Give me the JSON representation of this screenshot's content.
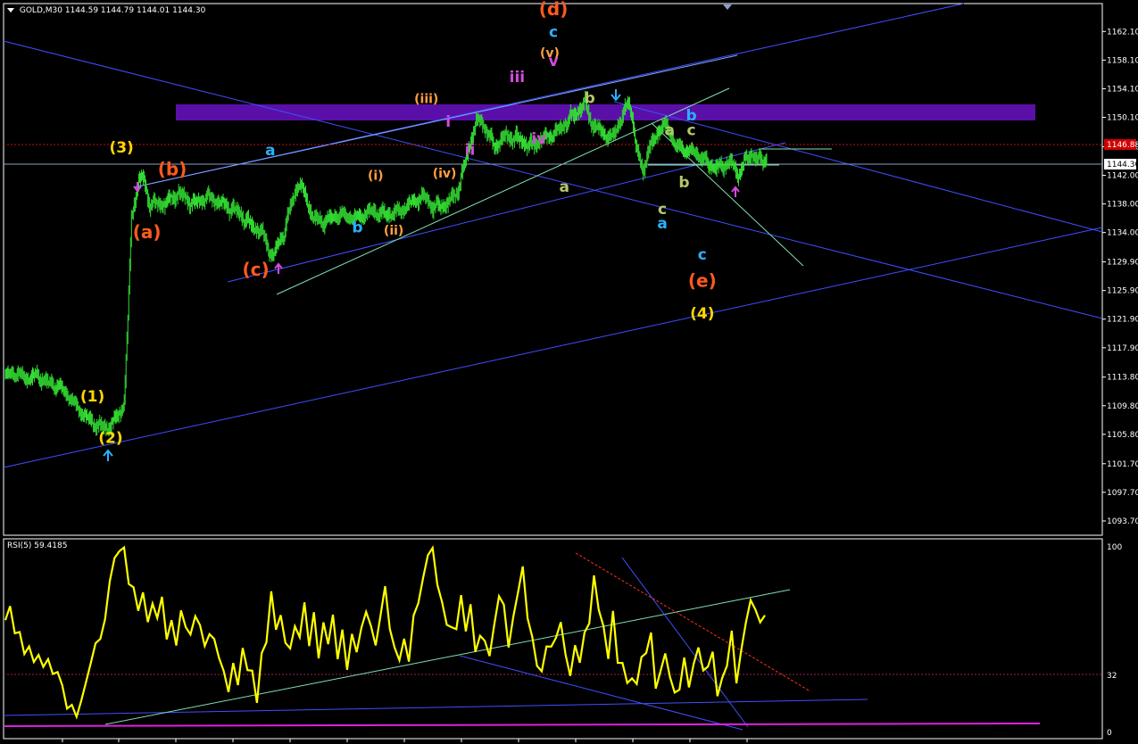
{
  "header": {
    "symbol": "GOLD,M30",
    "ohlc": "1144.59 1144.79 1144.01 1144.30"
  },
  "rsi_header": {
    "label": "RSI(5) 59.4185"
  },
  "colors": {
    "background": "#000000",
    "candle": "#33dd33",
    "rsi_line": "#ffff00",
    "grid_text": "#ffffff",
    "channel": "#3f4fff",
    "zone": "#5a10a8",
    "orange": "#ff5a1f",
    "yellow": "#ffd700",
    "cyan": "#2ab0ff",
    "olive": "#b5c76a",
    "magenta": "#d54be0",
    "amber": "#ffa040",
    "current_price_bg": "#ffffff",
    "high_price_bg": "#d00000"
  },
  "chart_data": [
    {
      "type": "candlestick",
      "title": "GOLD,M30",
      "ylim": [
        1091.7,
        1166.0
      ],
      "y_ticks": [
        "1162.10",
        "1158.10",
        "1154.10",
        "1150.10",
        "1146.00",
        "1142.00",
        "1138.00",
        "1134.00",
        "1129.90",
        "1125.90",
        "1121.90",
        "1117.90",
        "1113.80",
        "1109.80",
        "1105.80",
        "1101.70",
        "1097.70",
        "1093.70"
      ],
      "current_price": "1144.30",
      "high_price": "1146.88",
      "close_path": [
        [
          0,
          1114
        ],
        [
          3,
          1114.4
        ],
        [
          6,
          1113.6
        ],
        [
          9,
          1114
        ],
        [
          12,
          1113
        ],
        [
          15,
          1112.5
        ],
        [
          18,
          1111
        ],
        [
          20,
          1109.5
        ],
        [
          22,
          1108.5
        ],
        [
          24,
          1107.5
        ],
        [
          26,
          1107
        ],
        [
          28,
          1106.6
        ],
        [
          30,
          1107.5
        ],
        [
          32,
          1109
        ],
        [
          33,
          1110.5
        ],
        [
          34,
          1122
        ],
        [
          35,
          1136
        ],
        [
          36,
          1139
        ],
        [
          37,
          1141
        ],
        [
          38,
          1142
        ],
        [
          39,
          1140
        ],
        [
          40,
          1138
        ],
        [
          44,
          1138
        ],
        [
          48,
          1139.5
        ],
        [
          52,
          1138
        ],
        [
          56,
          1139
        ],
        [
          60,
          1138
        ],
        [
          64,
          1137
        ],
        [
          68,
          1135
        ],
        [
          71,
          1134
        ],
        [
          73,
          1131.5
        ],
        [
          74,
          1130.5
        ],
        [
          75,
          1132
        ],
        [
          77,
          1134
        ],
        [
          79,
          1138
        ],
        [
          81,
          1141
        ],
        [
          83,
          1139
        ],
        [
          85,
          1136
        ],
        [
          88,
          1135.5
        ],
        [
          92,
          1136.5
        ],
        [
          97,
          1136
        ],
        [
          101,
          1137
        ],
        [
          105,
          1136.5
        ],
        [
          109,
          1137
        ],
        [
          113,
          1138.5
        ],
        [
          116,
          1139
        ],
        [
          118,
          1137.5
        ],
        [
          122,
          1138
        ],
        [
          125,
          1140
        ],
        [
          127,
          1144
        ],
        [
          129,
          1148
        ],
        [
          131,
          1150
        ],
        [
          133,
          1148
        ],
        [
          135,
          1146
        ],
        [
          138,
          1147.5
        ],
        [
          142,
          1147
        ],
        [
          145,
          1146
        ],
        [
          148,
          1147
        ],
        [
          152,
          1148
        ],
        [
          155,
          1149.5
        ],
        [
          158,
          1151
        ],
        [
          160,
          1152
        ],
        [
          162,
          1149
        ],
        [
          165,
          1148
        ],
        [
          167,
          1147
        ],
        [
          169,
          1149
        ],
        [
          171,
          1151
        ],
        [
          172,
          1152.5
        ],
        [
          173,
          1150
        ],
        [
          174,
          1146
        ],
        [
          175,
          1144
        ],
        [
          176,
          1142.5
        ],
        [
          177,
          1145
        ],
        [
          179,
          1147
        ],
        [
          181,
          1149
        ],
        [
          183,
          1148.5
        ],
        [
          185,
          1146
        ],
        [
          188,
          1145.5
        ],
        [
          191,
          1145
        ],
        [
          194,
          1143.5
        ],
        [
          197,
          1143
        ],
        [
          200,
          1144
        ],
        [
          202,
          1142
        ],
        [
          204,
          1144
        ],
        [
          206,
          1145
        ],
        [
          208,
          1144
        ],
        [
          210,
          1144.3
        ]
      ],
      "price_channel_zone": [
        1150.2,
        1152.3
      ]
    },
    {
      "type": "line",
      "title": "RSI(5) 59.4185",
      "ylim": [
        0,
        100
      ],
      "y_ticks": [
        "100",
        "32",
        "0"
      ],
      "series": [
        {
          "name": "RSI(5)",
          "values": [
            60,
            68,
            52,
            55,
            40,
            48,
            35,
            44,
            32,
            42,
            28,
            35,
            22,
            15,
            12,
            10,
            15,
            28,
            36,
            48,
            50,
            60,
            82,
            92,
            99,
            97,
            82,
            75,
            68,
            72,
            62,
            66,
            64,
            70,
            52,
            58,
            48,
            64,
            57,
            52,
            62,
            58,
            45,
            54,
            48,
            42,
            30,
            24,
            34,
            28,
            42,
            36,
            30,
            18,
            40,
            50,
            74,
            56,
            62,
            48,
            45,
            56,
            52,
            68,
            48,
            62,
            42,
            56,
            50,
            60,
            42,
            52,
            36,
            50,
            45,
            54,
            66,
            56,
            47,
            62,
            78,
            56,
            44,
            40,
            48,
            40,
            60,
            72,
            80,
            98,
            96,
            82,
            67,
            60,
            54,
            57,
            72,
            55,
            68,
            43,
            52,
            48,
            42,
            56,
            75,
            66,
            48,
            59,
            78,
            86,
            64,
            48,
            38,
            30,
            48,
            44,
            52,
            58,
            42,
            30,
            46,
            38,
            52,
            60,
            82,
            68,
            54,
            42,
            62,
            40,
            34,
            29,
            26,
            28,
            38,
            44,
            52,
            24,
            32,
            42,
            30,
            20,
            24,
            38,
            26,
            34,
            48,
            30,
            38,
            40,
            22,
            26,
            38,
            52,
            28,
            42,
            60,
            70,
            66,
            59,
            62
          ]
        }
      ]
    }
  ],
  "wave_labels": [
    {
      "text": "(1)",
      "color": "yellow",
      "at": [
        24,
        1110.4
      ]
    },
    {
      "text": "(2)",
      "color": "yellow",
      "at": [
        29,
        1104.6
      ]
    },
    {
      "text": "(3)",
      "color": "yellow",
      "at": [
        32,
        1145.2
      ]
    },
    {
      "text": "(4)",
      "color": "yellow",
      "at": [
        192,
        1122.0
      ]
    },
    {
      "text": "(a)",
      "color": "orange",
      "at": [
        39,
        1133.2
      ]
    },
    {
      "text": "(b)",
      "color": "orange",
      "at": [
        46,
        1142.0
      ]
    },
    {
      "text": "(c)",
      "color": "orange",
      "at": [
        69,
        1128.0
      ]
    },
    {
      "text": "(d)",
      "color": "orange",
      "at": [
        151,
        1164.4
      ]
    },
    {
      "text": "(e)",
      "color": "orange",
      "at": [
        192,
        1126.4
      ]
    },
    {
      "text": "a",
      "color": "cyan",
      "at": [
        73,
        1144.8
      ]
    },
    {
      "text": "b",
      "color": "cyan",
      "at": [
        97,
        1134.0
      ]
    },
    {
      "text": "c",
      "color": "cyan",
      "at": [
        151,
        1161.3
      ]
    },
    {
      "text": "a",
      "color": "cyan",
      "at": [
        181,
        1134.6
      ]
    },
    {
      "text": "b",
      "color": "cyan",
      "at": [
        189,
        1149.7
      ]
    },
    {
      "text": "c",
      "color": "cyan",
      "at": [
        192,
        1130.2
      ]
    },
    {
      "text": "(i)",
      "color": "amber",
      "at": [
        102,
        1141.4
      ]
    },
    {
      "text": "(ii)",
      "color": "amber",
      "at": [
        107,
        1133.7
      ]
    },
    {
      "text": "(iii)",
      "color": "amber",
      "at": [
        116,
        1152.1
      ]
    },
    {
      "text": "(iv)",
      "color": "amber",
      "at": [
        121,
        1141.7
      ]
    },
    {
      "text": "(v)",
      "color": "amber",
      "at": [
        150,
        1158.5
      ]
    },
    {
      "text": "i",
      "color": "magenta",
      "at": [
        122,
        1148.8
      ]
    },
    {
      "text": "ii",
      "color": "magenta",
      "at": [
        128,
        1144.9
      ]
    },
    {
      "text": "iii",
      "color": "magenta",
      "at": [
        141,
        1155.0
      ]
    },
    {
      "text": "iv",
      "color": "magenta",
      "at": [
        147,
        1146.4
      ]
    },
    {
      "text": "v",
      "color": "magenta",
      "at": [
        151,
        1157.3
      ]
    },
    {
      "text": "a",
      "color": "olive",
      "at": [
        154,
        1139.7
      ]
    },
    {
      "text": "b",
      "color": "olive",
      "at": [
        161,
        1152.1
      ]
    },
    {
      "text": "a",
      "color": "olive",
      "at": [
        183,
        1147.6
      ]
    },
    {
      "text": "b",
      "color": "olive",
      "at": [
        187,
        1140.3
      ]
    },
    {
      "text": "c",
      "color": "olive",
      "at": [
        181,
        1136.6
      ]
    },
    {
      "text": "c",
      "color": "olive",
      "at": [
        189,
        1147.6
      ]
    }
  ]
}
